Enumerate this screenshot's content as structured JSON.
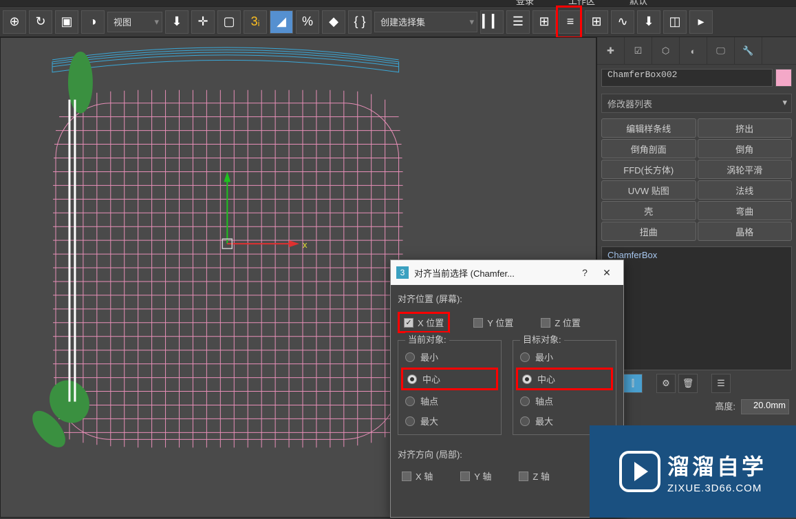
{
  "top_menu": {
    "login": "登录",
    "workspace": "工作区",
    "default": "默认"
  },
  "toolbar": {
    "view_dropdown": "视图",
    "selection_set": "创建选择集"
  },
  "right_panel": {
    "object_name": "ChamferBox002",
    "modifier_list": "修改器列表",
    "modifier_buttons": [
      {
        "label": "编辑样条线"
      },
      {
        "label": "挤出"
      },
      {
        "label": "倒角剖面"
      },
      {
        "label": "倒角"
      },
      {
        "label": "FFD(长方体)"
      },
      {
        "label": "涡轮平滑"
      },
      {
        "label": "UVW 贴图"
      },
      {
        "label": "法线"
      },
      {
        "label": "壳"
      },
      {
        "label": "弯曲"
      },
      {
        "label": "扭曲"
      },
      {
        "label": "晶格"
      }
    ],
    "stack_item": "ChamferBox",
    "param_height_label": "高度:",
    "param_height_value": "20.0mm"
  },
  "dialog": {
    "title": "对齐当前选择 (Chamfer...",
    "align_position_header": "对齐位置 (屏幕):",
    "x_position": "X 位置",
    "y_position": "Y 位置",
    "z_position": "Z 位置",
    "x_position_checked": true,
    "y_position_checked": false,
    "z_position_checked": false,
    "current_object_title": "当前对象:",
    "target_object_title": "目标对象:",
    "radio_options": {
      "min": "最小",
      "center": "中心",
      "pivot": "轴点",
      "max": "最大"
    },
    "align_orientation_header": "对齐方向 (局部):",
    "x_axis": "X 轴",
    "y_axis": "Y 轴",
    "z_axis": "Z 轴"
  },
  "watermark": {
    "line1": "溜溜自学",
    "line2": "ZIXUE.3D66.COM"
  }
}
